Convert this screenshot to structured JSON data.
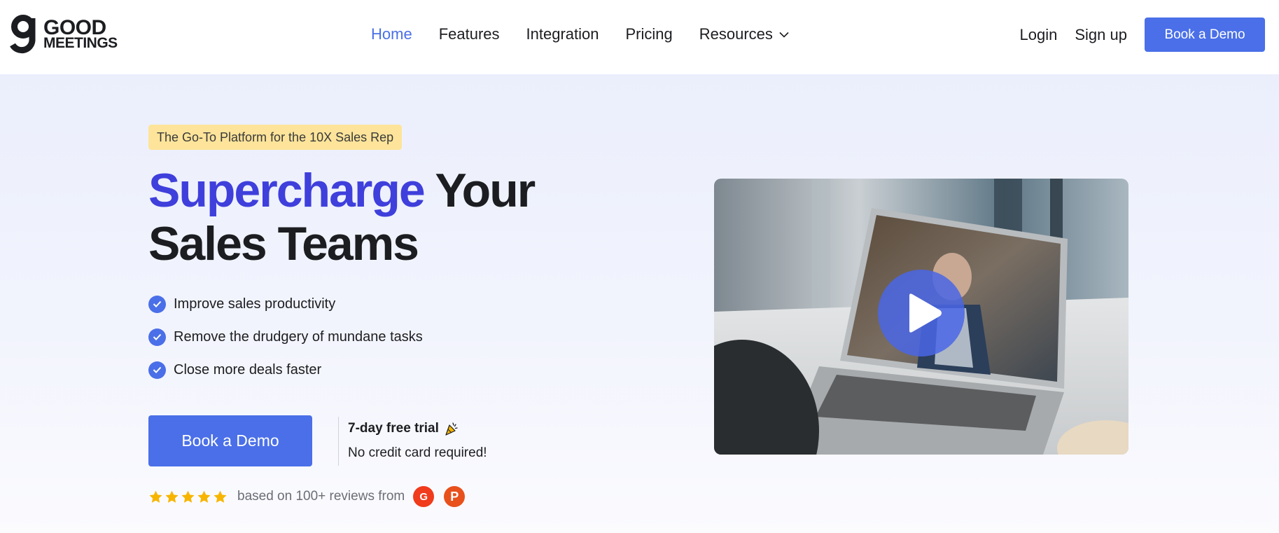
{
  "brand": {
    "line1": "GOOD",
    "line2": "MEETINGS",
    "accent_color": "#4a6fe8",
    "headline_highlight_color": "#3f3fdc"
  },
  "nav": {
    "items": [
      {
        "label": "Home",
        "active": true
      },
      {
        "label": "Features",
        "active": false
      },
      {
        "label": "Integration",
        "active": false
      },
      {
        "label": "Pricing",
        "active": false
      },
      {
        "label": "Resources",
        "active": false,
        "icon": "chevron-down-icon"
      }
    ]
  },
  "auth": {
    "login": "Login",
    "signup": "Sign up",
    "demo_button": "Book a Demo"
  },
  "hero": {
    "badge": "The Go-To Platform for the 10X Sales Rep",
    "headline_highlight": "Supercharge",
    "headline_rest_line1": " Your",
    "headline_line2": "Sales Teams",
    "features": [
      "Improve sales productivity",
      "Remove the drudgery of mundane tasks",
      "Close more deals faster"
    ],
    "cta_button": "Book a Demo",
    "trial_title": "7-day free trial",
    "trial_subtitle": "No credit card required!",
    "rating_stars": 5,
    "reviews_text": "based on 100+ reviews from",
    "review_sources": [
      {
        "name": "G2",
        "mark": "G",
        "color": "#f03b1c"
      },
      {
        "name": "Product Hunt",
        "mark": "P",
        "color": "#e8501c"
      }
    ]
  },
  "video": {
    "icon": "play-icon"
  }
}
